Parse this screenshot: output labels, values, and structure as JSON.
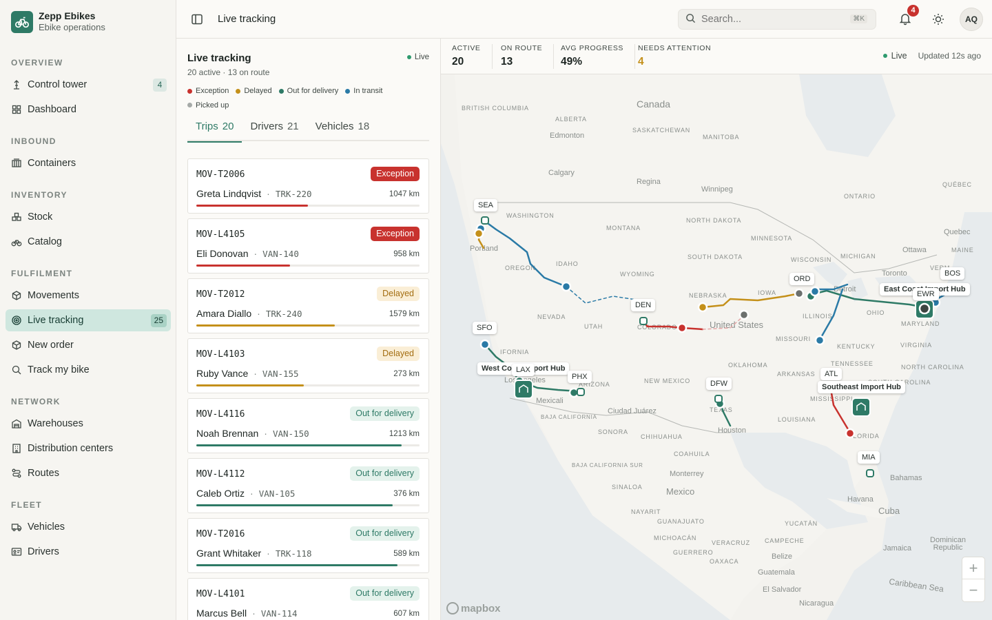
{
  "app": {
    "name": "Zepp Ebikes",
    "subtitle": "Ebike operations",
    "logo_icon": "bike-icon"
  },
  "sidebar": {
    "sections": [
      {
        "title": "OVERVIEW",
        "items": [
          {
            "label": "Control tower",
            "icon": "tower-icon",
            "badge": "4"
          },
          {
            "label": "Dashboard",
            "icon": "grid-icon"
          }
        ]
      },
      {
        "title": "INBOUND",
        "items": [
          {
            "label": "Containers",
            "icon": "container-icon"
          }
        ]
      },
      {
        "title": "INVENTORY",
        "items": [
          {
            "label": "Stock",
            "icon": "boxes-icon"
          },
          {
            "label": "Catalog",
            "icon": "bike-icon"
          }
        ]
      },
      {
        "title": "FULFILMENT",
        "items": [
          {
            "label": "Movements",
            "icon": "package-icon"
          },
          {
            "label": "Live tracking",
            "icon": "radar-icon",
            "badge": "25",
            "active": true
          },
          {
            "label": "New order",
            "icon": "cube-icon"
          },
          {
            "label": "Track my bike",
            "icon": "search-icon"
          }
        ]
      },
      {
        "title": "NETWORK",
        "items": [
          {
            "label": "Warehouses",
            "icon": "warehouse-icon"
          },
          {
            "label": "Distribution centers",
            "icon": "building-icon"
          },
          {
            "label": "Routes",
            "icon": "route-icon"
          }
        ]
      },
      {
        "title": "FLEET",
        "items": [
          {
            "label": "Vehicles",
            "icon": "truck-icon"
          },
          {
            "label": "Drivers",
            "icon": "id-card-icon"
          }
        ]
      }
    ]
  },
  "header": {
    "title": "Live tracking",
    "search_placeholder": "Search...",
    "search_shortcut": "⌘K",
    "notifications": "4",
    "user_initials": "AQ"
  },
  "panel": {
    "title": "Live tracking",
    "live_label": "Live",
    "summary": "20 active · 13 on route",
    "legend": [
      {
        "label": "Exception",
        "color": "#c8322e"
      },
      {
        "label": "Delayed",
        "color": "#c4901a"
      },
      {
        "label": "Out for delivery",
        "color": "#2e7a66"
      },
      {
        "label": "In transit",
        "color": "#2a7aa6"
      },
      {
        "label": "Picked up",
        "color": "#a6aaa8"
      }
    ],
    "tabs": [
      {
        "label": "Trips",
        "count": "20",
        "active": true
      },
      {
        "label": "Drivers",
        "count": "21"
      },
      {
        "label": "Vehicles",
        "count": "18"
      }
    ],
    "trips": [
      {
        "id": "MOV-T2006",
        "status": "Exception",
        "kind": "exc",
        "driver": "Greta Lindqvist",
        "vehicle": "TRK-220",
        "distance": "1047 km",
        "progress": 0.5,
        "color": "#c8322e"
      },
      {
        "id": "MOV-L4105",
        "status": "Exception",
        "kind": "exc",
        "driver": "Eli Donovan",
        "vehicle": "VAN-140",
        "distance": "958 km",
        "progress": 0.42,
        "color": "#c8322e"
      },
      {
        "id": "MOV-T2012",
        "status": "Delayed",
        "kind": "del",
        "driver": "Amara Diallo",
        "vehicle": "TRK-240",
        "distance": "1579 km",
        "progress": 0.62,
        "color": "#c4901a"
      },
      {
        "id": "MOV-L4103",
        "status": "Delayed",
        "kind": "del",
        "driver": "Ruby Vance",
        "vehicle": "VAN-155",
        "distance": "273 km",
        "progress": 0.48,
        "color": "#c4901a"
      },
      {
        "id": "MOV-L4116",
        "status": "Out for delivery",
        "kind": "out",
        "driver": "Noah Brennan",
        "vehicle": "VAN-150",
        "distance": "1213 km",
        "progress": 0.92,
        "color": "#2e7a66"
      },
      {
        "id": "MOV-L4112",
        "status": "Out for delivery",
        "kind": "out",
        "driver": "Caleb Ortiz",
        "vehicle": "VAN-105",
        "distance": "376 km",
        "progress": 0.88,
        "color": "#2e7a66"
      },
      {
        "id": "MOV-T2016",
        "status": "Out for delivery",
        "kind": "out",
        "driver": "Grant Whitaker",
        "vehicle": "TRK-118",
        "distance": "589 km",
        "progress": 0.9,
        "color": "#2e7a66"
      },
      {
        "id": "MOV-L4101",
        "status": "Out for delivery",
        "kind": "out",
        "driver": "Marcus Bell",
        "vehicle": "VAN-114",
        "distance": "607 km",
        "progress": 0.85,
        "color": "#2e7a66"
      }
    ]
  },
  "stats": {
    "items": [
      {
        "label": "ACTIVE",
        "value": "20"
      },
      {
        "label": "ON ROUTE",
        "value": "13"
      },
      {
        "label": "AVG PROGRESS",
        "value": "49%"
      },
      {
        "label": "NEEDS ATTENTION",
        "value": "4",
        "color": "#c4901a"
      }
    ],
    "live_label": "Live",
    "updated": "Updated 12s ago"
  },
  "map": {
    "regions": [
      "Canada",
      "United States",
      "Mexico",
      "Cuba",
      "BRITISH COLUMBIA",
      "ALBERTA",
      "SASKATCHEWAN",
      "MANITOBA",
      "ONTARIO",
      "QUÉBEC",
      "WASHINGTON",
      "OREGON",
      "IDAHO",
      "MONTANA",
      "WYOMING",
      "NEVADA",
      "UTAH",
      "COLORADO",
      "NORTH DAKOTA",
      "SOUTH DAKOTA",
      "NEBRASKA",
      "MINNESOTA",
      "WISCONSIN",
      "MICHIGAN",
      "IOWA",
      "ILLINOIS",
      "OHIO",
      "MISSOURI",
      "KENTUCKY",
      "TENNESSEE",
      "ARKANSAS",
      "OKLAHOMA",
      "TEXAS",
      "NEW MEXICO",
      "ARIZONA",
      "LOUISIANA",
      "MISSISSIPPI",
      "MARYLAND",
      "VIRGINIA",
      "NORTH CAROLINA",
      "SOUTH CAROLINA",
      "FLORIDA",
      "IFORNIA",
      "MAINE",
      "VERM",
      "BAJA CALIFORNIA",
      "SONORA",
      "CHIHUAHUA",
      "COAHUILA",
      "BAJA CALIFORNIA SUR",
      "SINALOA",
      "NAYARIT",
      "GUANAJUATO",
      "MICHOACÁN",
      "GUERRERO",
      "OAXACA",
      "VERACRUZ",
      "CAMPECHE",
      "YUCATÁN",
      "Caribbean Sea"
    ],
    "cities": [
      "Edmonton",
      "Calgary",
      "Regina",
      "Winnipeg",
      "Quebec",
      "Ottawa",
      "Toronto",
      "Portland",
      "Los Angeles",
      "Mexicali",
      "Ciudad Juárez",
      "Houston",
      "Monterrey",
      "Havana",
      "Bahamas",
      "Belize",
      "Guatemala",
      "El Salvador",
      "Nicaragua",
      "Jamaica",
      "Dominican Republic",
      "Detroit"
    ],
    "nodes": [
      "SEA",
      "SFO",
      "LAX",
      "PHX",
      "DEN",
      "DFW",
      "ORD",
      "ATL",
      "MIA",
      "EWR",
      "BOS"
    ],
    "hubs": [
      "West Coast Import Hub",
      "East Coast Import Hub",
      "Southeast Import Hub"
    ],
    "attribution": "mapbox",
    "zoom_in": "+",
    "zoom_out": "−"
  }
}
